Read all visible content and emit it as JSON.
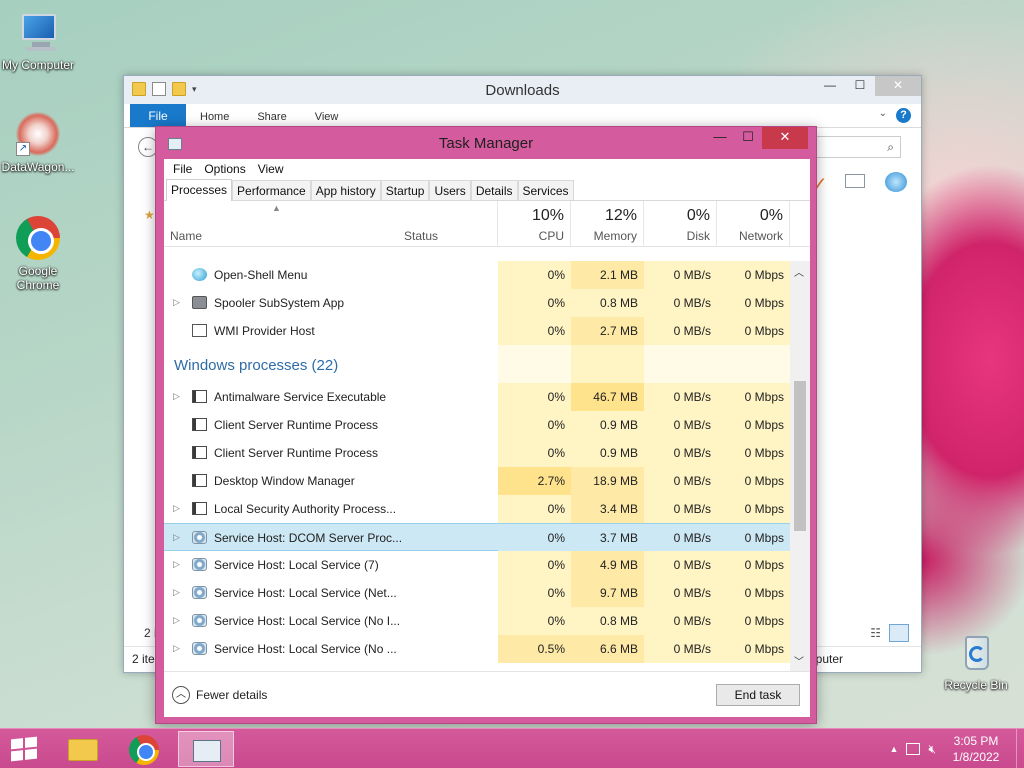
{
  "desktop": {
    "icons": [
      {
        "label": "My Computer"
      },
      {
        "label": "DataWagon..."
      },
      {
        "label": "Google Chrome"
      },
      {
        "label": "Recycle Bin"
      }
    ]
  },
  "explorer": {
    "title": "Downloads",
    "ribbon_tabs": [
      "File",
      "Home",
      "Share",
      "View"
    ],
    "help": "?",
    "status_left": "2 ite",
    "status_left_frag": "2 i",
    "status_right": "puter"
  },
  "task_manager": {
    "title": "Task Manager",
    "menu": [
      "File",
      "Options",
      "View"
    ],
    "tabs": [
      "Processes",
      "Performance",
      "App history",
      "Startup",
      "Users",
      "Details",
      "Services"
    ],
    "active_tab": "Processes",
    "columns": {
      "name": "Name",
      "status": "Status",
      "cpu": {
        "pct": "10%",
        "label": "CPU"
      },
      "memory": {
        "pct": "12%",
        "label": "Memory"
      },
      "disk": {
        "pct": "0%",
        "label": "Disk"
      },
      "network": {
        "pct": "0%",
        "label": "Network"
      }
    },
    "processes_top": [
      {
        "name": "Open-Shell Menu",
        "icon": "shell-icon",
        "expandable": false,
        "cpu": "0%",
        "memory": "2.1 MB",
        "disk": "0 MB/s",
        "network": "0 Mbps"
      },
      {
        "name": "Spooler SubSystem App",
        "icon": "printer-icon",
        "expandable": true,
        "cpu": "0%",
        "memory": "0.8 MB",
        "disk": "0 MB/s",
        "network": "0 Mbps"
      },
      {
        "name": "WMI Provider Host",
        "icon": "wmi-icon",
        "expandable": false,
        "cpu": "0%",
        "memory": "2.7 MB",
        "disk": "0 MB/s",
        "network": "0 Mbps"
      }
    ],
    "group_title": "Windows processes (22)",
    "windows_processes": [
      {
        "name": "Antimalware Service Executable",
        "icon": "window-icon",
        "expandable": true,
        "cpu": "0%",
        "memory": "46.7 MB",
        "disk": "0 MB/s",
        "network": "0 Mbps"
      },
      {
        "name": "Client Server Runtime Process",
        "icon": "window-icon",
        "expandable": false,
        "cpu": "0%",
        "memory": "0.9 MB",
        "disk": "0 MB/s",
        "network": "0 Mbps"
      },
      {
        "name": "Client Server Runtime Process",
        "icon": "window-icon",
        "expandable": false,
        "cpu": "0%",
        "memory": "0.9 MB",
        "disk": "0 MB/s",
        "network": "0 Mbps"
      },
      {
        "name": "Desktop Window Manager",
        "icon": "window-icon",
        "expandable": false,
        "cpu": "2.7%",
        "memory": "18.9 MB",
        "disk": "0 MB/s",
        "network": "0 Mbps"
      },
      {
        "name": "Local Security Authority Process...",
        "icon": "window-icon",
        "expandable": true,
        "cpu": "0%",
        "memory": "3.4 MB",
        "disk": "0 MB/s",
        "network": "0 Mbps"
      },
      {
        "name": "Service Host: DCOM Server Proc...",
        "icon": "gear-icon",
        "expandable": true,
        "selected": true,
        "cpu": "0%",
        "memory": "3.7 MB",
        "disk": "0 MB/s",
        "network": "0 Mbps"
      },
      {
        "name": "Service Host: Local Service (7)",
        "icon": "gear-icon",
        "expandable": true,
        "cpu": "0%",
        "memory": "4.9 MB",
        "disk": "0 MB/s",
        "network": "0 Mbps"
      },
      {
        "name": "Service Host: Local Service (Net...",
        "icon": "gear-icon",
        "expandable": true,
        "cpu": "0%",
        "memory": "9.7 MB",
        "disk": "0 MB/s",
        "network": "0 Mbps"
      },
      {
        "name": "Service Host: Local Service (No I...",
        "icon": "gear-icon",
        "expandable": true,
        "cpu": "0%",
        "memory": "0.8 MB",
        "disk": "0 MB/s",
        "network": "0 Mbps"
      },
      {
        "name": "Service Host: Local Service (No ...",
        "icon": "gear-icon",
        "expandable": true,
        "cpu": "0.5%",
        "memory": "6.6 MB",
        "disk": "0 MB/s",
        "network": "0 Mbps"
      }
    ],
    "fewer_details": "Fewer details",
    "end_task": "End task"
  },
  "taskbar": {
    "clock_time": "3:05 PM",
    "clock_date": "1/8/2022"
  }
}
